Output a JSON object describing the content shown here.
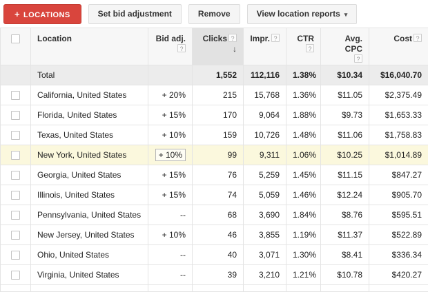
{
  "toolbar": {
    "locations_label": "LOCATIONS",
    "set_bid_adjustment": "Set bid adjustment",
    "remove": "Remove",
    "view_location_reports": "View location reports"
  },
  "icons": {
    "plus": "+",
    "help": "?",
    "sort_desc": "↓",
    "dropdown_caret": "▾"
  },
  "colors": {
    "accent_red": "#d9453d",
    "sorted_column_header": "#e2e2e2",
    "total_row_bg": "#ececec",
    "highlight_row_bg": "#fbf8dd"
  },
  "table": {
    "columns": [
      {
        "key": "location",
        "label": "Location",
        "align": "left",
        "help": "none"
      },
      {
        "key": "bid_adj",
        "label": "Bid adj.",
        "align": "right",
        "help": "below"
      },
      {
        "key": "clicks",
        "label": "Clicks",
        "align": "right",
        "help": "inline",
        "sorted": true
      },
      {
        "key": "impr",
        "label": "Impr.",
        "align": "right",
        "help": "inline"
      },
      {
        "key": "ctr",
        "label": "CTR",
        "align": "right",
        "help": "inline"
      },
      {
        "key": "avg_cpc",
        "label": "Avg. CPC",
        "align": "right",
        "help": "below"
      },
      {
        "key": "cost",
        "label": "Cost",
        "align": "right",
        "help": "inline"
      }
    ],
    "total_row": {
      "location": "Total",
      "bid_adj": "",
      "clicks": "1,552",
      "impr": "112,116",
      "ctr": "1.38%",
      "avg_cpc": "$10.34",
      "cost": "$16,040.70"
    },
    "rows": [
      {
        "location": "California, United States",
        "bid_adj": "+ 20%",
        "clicks": "215",
        "impr": "15,768",
        "ctr": "1.36%",
        "avg_cpc": "$11.05",
        "cost": "$2,375.49"
      },
      {
        "location": "Florida, United States",
        "bid_adj": "+ 15%",
        "clicks": "170",
        "impr": "9,064",
        "ctr": "1.88%",
        "avg_cpc": "$9.73",
        "cost": "$1,653.33"
      },
      {
        "location": "Texas, United States",
        "bid_adj": "+ 10%",
        "clicks": "159",
        "impr": "10,726",
        "ctr": "1.48%",
        "avg_cpc": "$11.06",
        "cost": "$1,758.83"
      },
      {
        "location": "New York, United States",
        "bid_adj": "+ 10%",
        "clicks": "99",
        "impr": "9,311",
        "ctr": "1.06%",
        "avg_cpc": "$10.25",
        "cost": "$1,014.89",
        "highlighted": true,
        "bid_editable": true
      },
      {
        "location": "Georgia, United States",
        "bid_adj": "+ 15%",
        "clicks": "76",
        "impr": "5,259",
        "ctr": "1.45%",
        "avg_cpc": "$11.15",
        "cost": "$847.27"
      },
      {
        "location": "Illinois, United States",
        "bid_adj": "+ 15%",
        "clicks": "74",
        "impr": "5,059",
        "ctr": "1.46%",
        "avg_cpc": "$12.24",
        "cost": "$905.70"
      },
      {
        "location": "Pennsylvania, United States",
        "bid_adj": "--",
        "clicks": "68",
        "impr": "3,690",
        "ctr": "1.84%",
        "avg_cpc": "$8.76",
        "cost": "$595.51"
      },
      {
        "location": "New Jersey, United States",
        "bid_adj": "+ 10%",
        "clicks": "46",
        "impr": "3,855",
        "ctr": "1.19%",
        "avg_cpc": "$11.37",
        "cost": "$522.89"
      },
      {
        "location": "Ohio, United States",
        "bid_adj": "--",
        "clicks": "40",
        "impr": "3,071",
        "ctr": "1.30%",
        "avg_cpc": "$8.41",
        "cost": "$336.34"
      },
      {
        "location": "Virginia, United States",
        "bid_adj": "--",
        "clicks": "39",
        "impr": "3,210",
        "ctr": "1.21%",
        "avg_cpc": "$10.78",
        "cost": "$420.27"
      }
    ]
  }
}
